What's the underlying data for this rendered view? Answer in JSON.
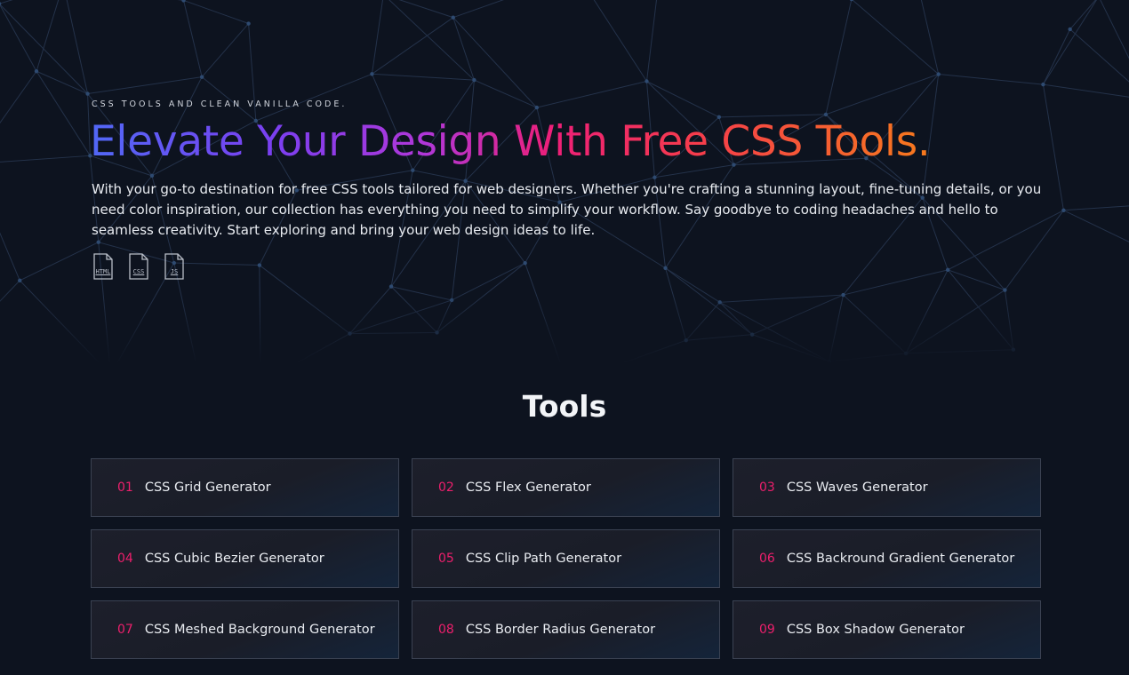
{
  "hero": {
    "eyebrow": "CSS TOOLS AND CLEAN VANILLA CODE.",
    "headline": "Elevate Your Design With Free CSS Tools.",
    "intro": "With your go-to destination for free CSS tools tailored for web designers. Whether you're crafting a stunning layout, fine-tuning details, or you need color inspiration, our collection has everything you need to simplify your workflow. Say goodbye to coding headaches and hello to seamless creativity. Start exploring and bring your web design ideas to life.",
    "badges": [
      {
        "label": "HTML",
        "icon": "html-file-icon"
      },
      {
        "label": "CSS",
        "icon": "css-file-icon"
      },
      {
        "label": "JS",
        "icon": "js-file-icon"
      }
    ],
    "gradient_colors": [
      "#5168f6",
      "#7b3ff0",
      "#b137d8",
      "#ed1f78",
      "#f53c4c",
      "#f77a1c"
    ]
  },
  "tools": {
    "title": "Tools",
    "accent_color": "#ed1f6c",
    "items": [
      {
        "num": "01",
        "label": "CSS Grid Generator"
      },
      {
        "num": "02",
        "label": "CSS Flex Generator"
      },
      {
        "num": "03",
        "label": "CSS Waves Generator"
      },
      {
        "num": "04",
        "label": "CSS Cubic Bezier Generator"
      },
      {
        "num": "05",
        "label": "CSS Clip Path Generator"
      },
      {
        "num": "06",
        "label": "CSS Backround Gradient Generator"
      },
      {
        "num": "07",
        "label": "CSS Meshed Background Generator"
      },
      {
        "num": "08",
        "label": "CSS Border Radius Generator"
      },
      {
        "num": "09",
        "label": "CSS Box Shadow Generator"
      }
    ]
  }
}
